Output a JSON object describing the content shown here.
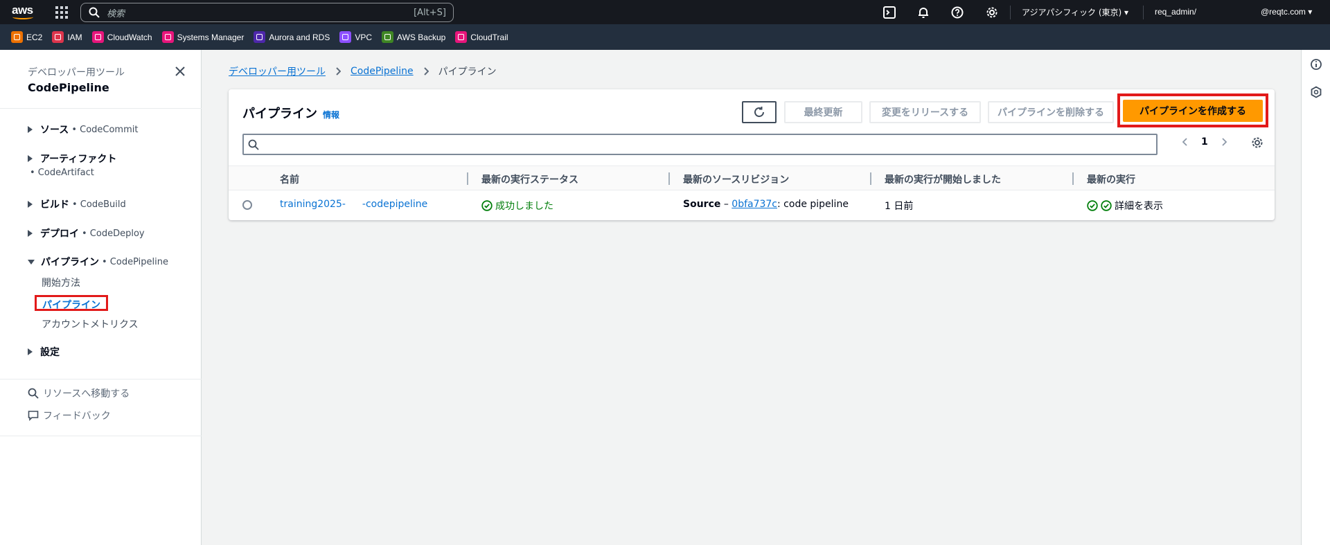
{
  "topnav": {
    "search_placeholder": "検索",
    "search_shortcut": "[Alt+S]",
    "region": "アジアパシフィック (東京) ▾",
    "user": "req_admin/",
    "account": "@reqtc.com ▾",
    "logo_text": "aws"
  },
  "favorites": [
    {
      "label": "EC2",
      "color": "#ed7100"
    },
    {
      "label": "IAM",
      "color": "#dd344c"
    },
    {
      "label": "CloudWatch",
      "color": "#e7157b"
    },
    {
      "label": "Systems Manager",
      "color": "#e7157b"
    },
    {
      "label": "Aurora and RDS",
      "color": "#4d27aa"
    },
    {
      "label": "VPC",
      "color": "#8c4fff"
    },
    {
      "label": "AWS Backup",
      "color": "#3f8624"
    },
    {
      "label": "CloudTrail",
      "color": "#e7157b"
    }
  ],
  "sidebar": {
    "subtitle": "デベロッパー用ツール",
    "title": "CodePipeline",
    "sections": [
      {
        "label": "ソース",
        "service": "• CodeCommit"
      },
      {
        "label": "アーティファクト",
        "service": "• CodeArtifact"
      },
      {
        "label": "ビルド",
        "service": "• CodeBuild"
      },
      {
        "label": "デプロイ",
        "service": "• CodeDeploy"
      },
      {
        "label": "パイプライン",
        "service": "• CodePipeline"
      },
      {
        "label": "設定",
        "service": ""
      }
    ],
    "pipeline_links": [
      "開始方法",
      "パイプライン",
      "アカウントメトリクス"
    ],
    "goto_resource": "リソースへ移動する",
    "feedback": "フィードバック"
  },
  "breadcrumbs": [
    "デベロッパー用ツール",
    "CodePipeline",
    "パイプライン"
  ],
  "panel": {
    "title": "パイプライン",
    "info": "情報",
    "buttons": {
      "last_updated": "最終更新",
      "release_change": "変更をリリースする",
      "delete": "パイプラインを削除する",
      "create": "パイプラインを作成する"
    },
    "page": "1",
    "columns": [
      "名前",
      "最新の実行ステータス",
      "最新のソースリビジョン",
      "最新の実行が開始しました",
      "最新の実行"
    ],
    "rows": [
      {
        "name_prefix": "training2025-",
        "name_suffix": "-codepipeline",
        "status": "成功しました",
        "source_label": "Source",
        "source_dash": " – ",
        "revision": "0bfa737c",
        "revision_msg": ": code pipeline",
        "started": "1 日前",
        "latest_exec": "詳細を表示"
      }
    ]
  },
  "colors": {
    "accent": "#0972d3",
    "primary_button": "#ff9900",
    "success": "#037f0c",
    "highlight": "#e21a1a"
  }
}
